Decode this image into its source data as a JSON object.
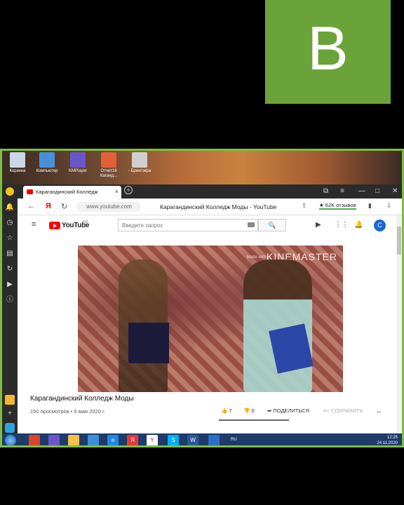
{
  "logo": {
    "letter": "B",
    "color": "#6aa33a"
  },
  "desktop": {
    "icons": [
      {
        "label": "Корзина",
        "icon": "trash-icon",
        "color": "#c9d6e3"
      },
      {
        "label": "Компьютер",
        "icon": "computer-icon",
        "color": "#4a8fd6"
      },
      {
        "label": "KMPlayer",
        "icon": "kmplayer-icon",
        "color": "#6b56c9"
      },
      {
        "label": "Отчет16 Каганд...",
        "icon": "document-icon",
        "color": "#e35f35"
      },
      {
        "label": "- Брингэкра",
        "icon": "file-icon",
        "color": "#cfcfcf"
      }
    ]
  },
  "browser": {
    "tab": {
      "title": "Карагандинский Колледж",
      "favicon": "youtube-favicon-icon"
    },
    "new_tab": "+",
    "window_controls": [
      "—",
      "□",
      "✕"
    ],
    "address": {
      "url": "www.youtube.com",
      "page_title": "Карагандинский Колледж Моды - YouTube",
      "reviews": "★ 62K отзывов"
    }
  },
  "youtube": {
    "logo_text": "YouTube",
    "region": "KZ",
    "search": {
      "placeholder": "Введите запрос"
    },
    "avatar_letter": "C",
    "video": {
      "watermark": "KINEMASTER",
      "watermark_small": "Made with",
      "title": "Карагандинский Колледж Моды",
      "meta": "150 просмотров • 5 мая 2020 г.",
      "likes": "7",
      "dislikes": "0",
      "share_label": "ПОДЕЛИТЬСЯ",
      "save_label": "СОХРАНИТЬ",
      "more": "..."
    }
  },
  "taskbar": {
    "lang": "RU",
    "time": "12:25",
    "date": "24.11.2020"
  }
}
